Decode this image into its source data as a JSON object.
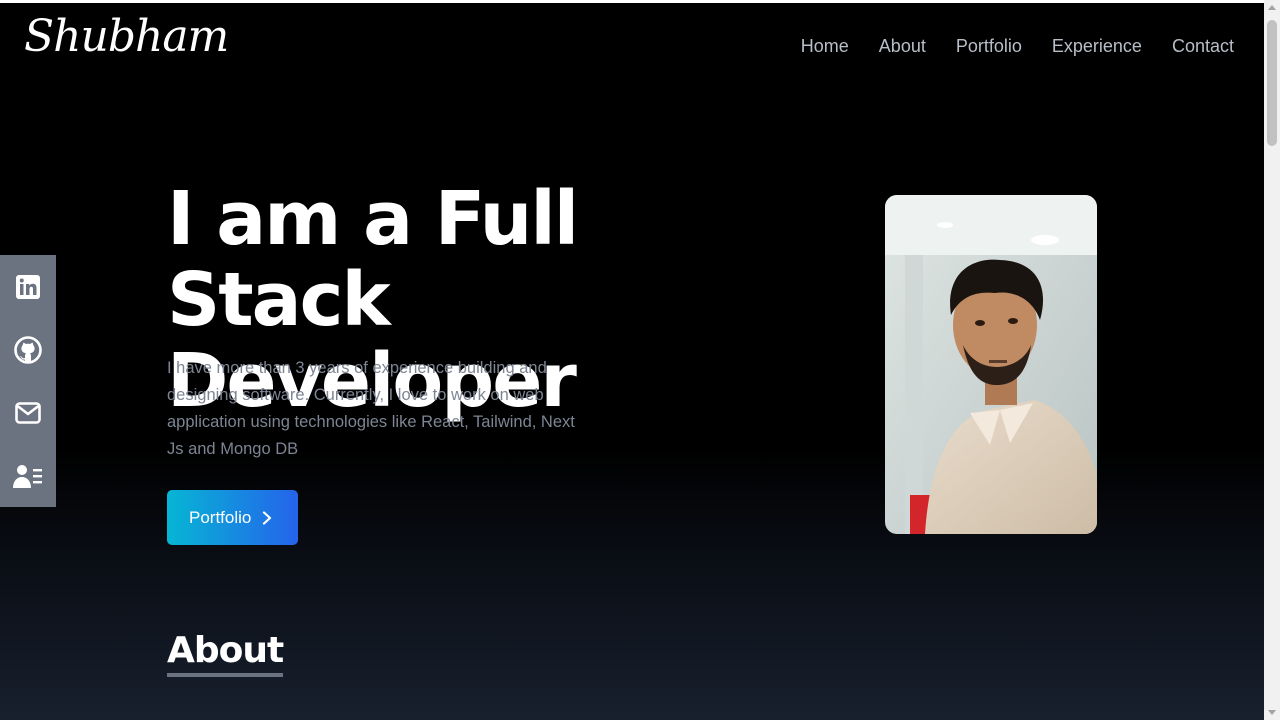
{
  "brand": {
    "logo_text": "Shubham"
  },
  "nav": {
    "items": [
      "Home",
      "About",
      "Portfolio",
      "Experience",
      "Contact"
    ]
  },
  "hero": {
    "title_line1": "I am a Full Stack",
    "title_line2": "Developer",
    "description": "I have more than 3 years of experience building and designing software. Currently, I love to work on web application using technologies like React, Tailwind, Next Js and Mongo DB",
    "cta_label": "Portfolio",
    "cta_icon": "chevron-right-icon",
    "photo_alt": "profile-photo"
  },
  "social": {
    "icons": [
      "linkedin-icon",
      "github-icon",
      "mail-icon",
      "resume-icon"
    ]
  },
  "about": {
    "title": "About"
  },
  "colors": {
    "background": "#000000",
    "cta_gradient_start": "#06b6d4",
    "cta_gradient_end": "#2563eb",
    "social_bar": "#6b7280",
    "nav_text": "#b8bec8"
  }
}
